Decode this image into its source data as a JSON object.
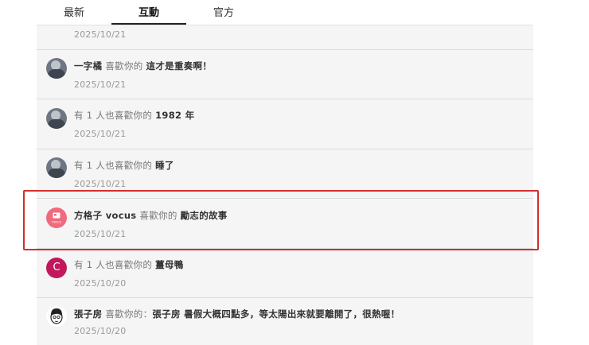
{
  "tabs": [
    {
      "label": "最新"
    },
    {
      "label": "互動"
    },
    {
      "label": "官方"
    }
  ],
  "active_tab": "互動",
  "notifications": [
    {
      "name": "",
      "action": "",
      "target": "",
      "date": "2025/10/21",
      "avatar": "photo"
    },
    {
      "name": "一字橘",
      "action": "喜歡你的",
      "target": "這才是重奏啊！",
      "date": "2025/10/21",
      "avatar": "photo"
    },
    {
      "name": "有 1 人也喜歡你的",
      "action": "",
      "target": "1982 年",
      "date": "2025/10/21",
      "avatar": "photo"
    },
    {
      "name": "有 1 人也喜歡你的",
      "action": "",
      "target": "睡了",
      "date": "2025/10/21",
      "avatar": "photo"
    },
    {
      "name": "方格子 vocus",
      "action": "喜歡你的",
      "target": "勵志的故事",
      "date": "2025/10/21",
      "avatar": "vocus",
      "avatar_label": "vocus"
    },
    {
      "name": "有 1 人也喜歡你的",
      "action": "",
      "target": "薑母鴨",
      "date": "2025/10/20",
      "avatar": "letter",
      "avatar_letter": "C"
    },
    {
      "name": "張子房",
      "action": "喜歡你的：",
      "target": "張子房 暑假大概四點多，等太陽出來就要離開了，很熱喔！",
      "date": "2025/10/20",
      "avatar": "sketch"
    }
  ],
  "colors": {
    "highlight": "#d0302f",
    "vocus_avatar": "#f06a7e",
    "letter_avatar": "#c2185b"
  }
}
